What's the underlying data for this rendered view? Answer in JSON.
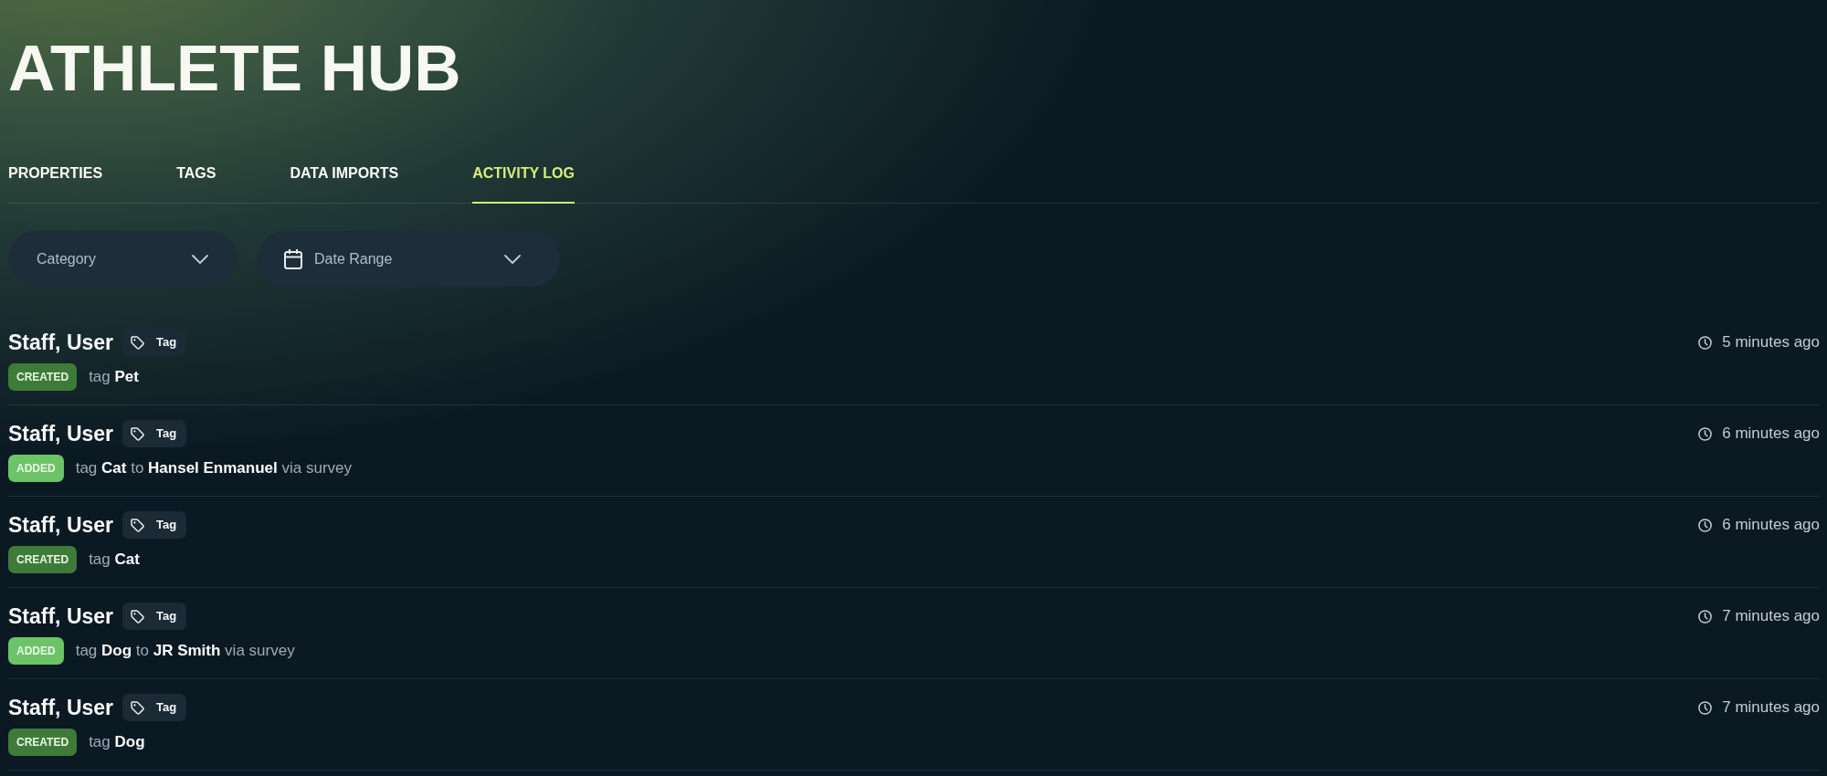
{
  "header": {
    "title": "ATHLETE HUB"
  },
  "tabs": [
    {
      "label": "PROPERTIES",
      "selected": false
    },
    {
      "label": "TAGS",
      "selected": false
    },
    {
      "label": "DATA IMPORTS",
      "selected": false
    },
    {
      "label": "ACTIVITY LOG",
      "selected": true
    }
  ],
  "filters": [
    {
      "kind": "select",
      "label": "Category"
    },
    {
      "kind": "date_range",
      "label": "Date Range"
    }
  ],
  "activity": [
    {
      "actor": "Staff, User",
      "entity": "Tag",
      "action": {
        "label": "CREATED",
        "color": "#3e7b39"
      },
      "description": "tag **Pet**",
      "time": "5 minutes ago"
    },
    {
      "actor": "Staff, User",
      "entity": "Tag",
      "action": {
        "label": "ADDED",
        "color": "#6cc368"
      },
      "description": "tag **Cat** to **Hansel Enmanuel** via survey",
      "time": "6 minutes ago"
    },
    {
      "actor": "Staff, User",
      "entity": "Tag",
      "action": {
        "label": "CREATED",
        "color": "#3e7b39"
      },
      "description": "tag **Cat**",
      "time": "6 minutes ago"
    },
    {
      "actor": "Staff, User",
      "entity": "Tag",
      "action": {
        "label": "ADDED",
        "color": "#6cc368"
      },
      "description": "tag **Dog** to **JR Smith** via survey",
      "time": "7 minutes ago"
    },
    {
      "actor": "Staff, User",
      "entity": "Tag",
      "action": {
        "label": "CREATED",
        "color": "#3e7b39"
      },
      "description": "tag **Dog**",
      "time": "7 minutes ago"
    }
  ]
}
